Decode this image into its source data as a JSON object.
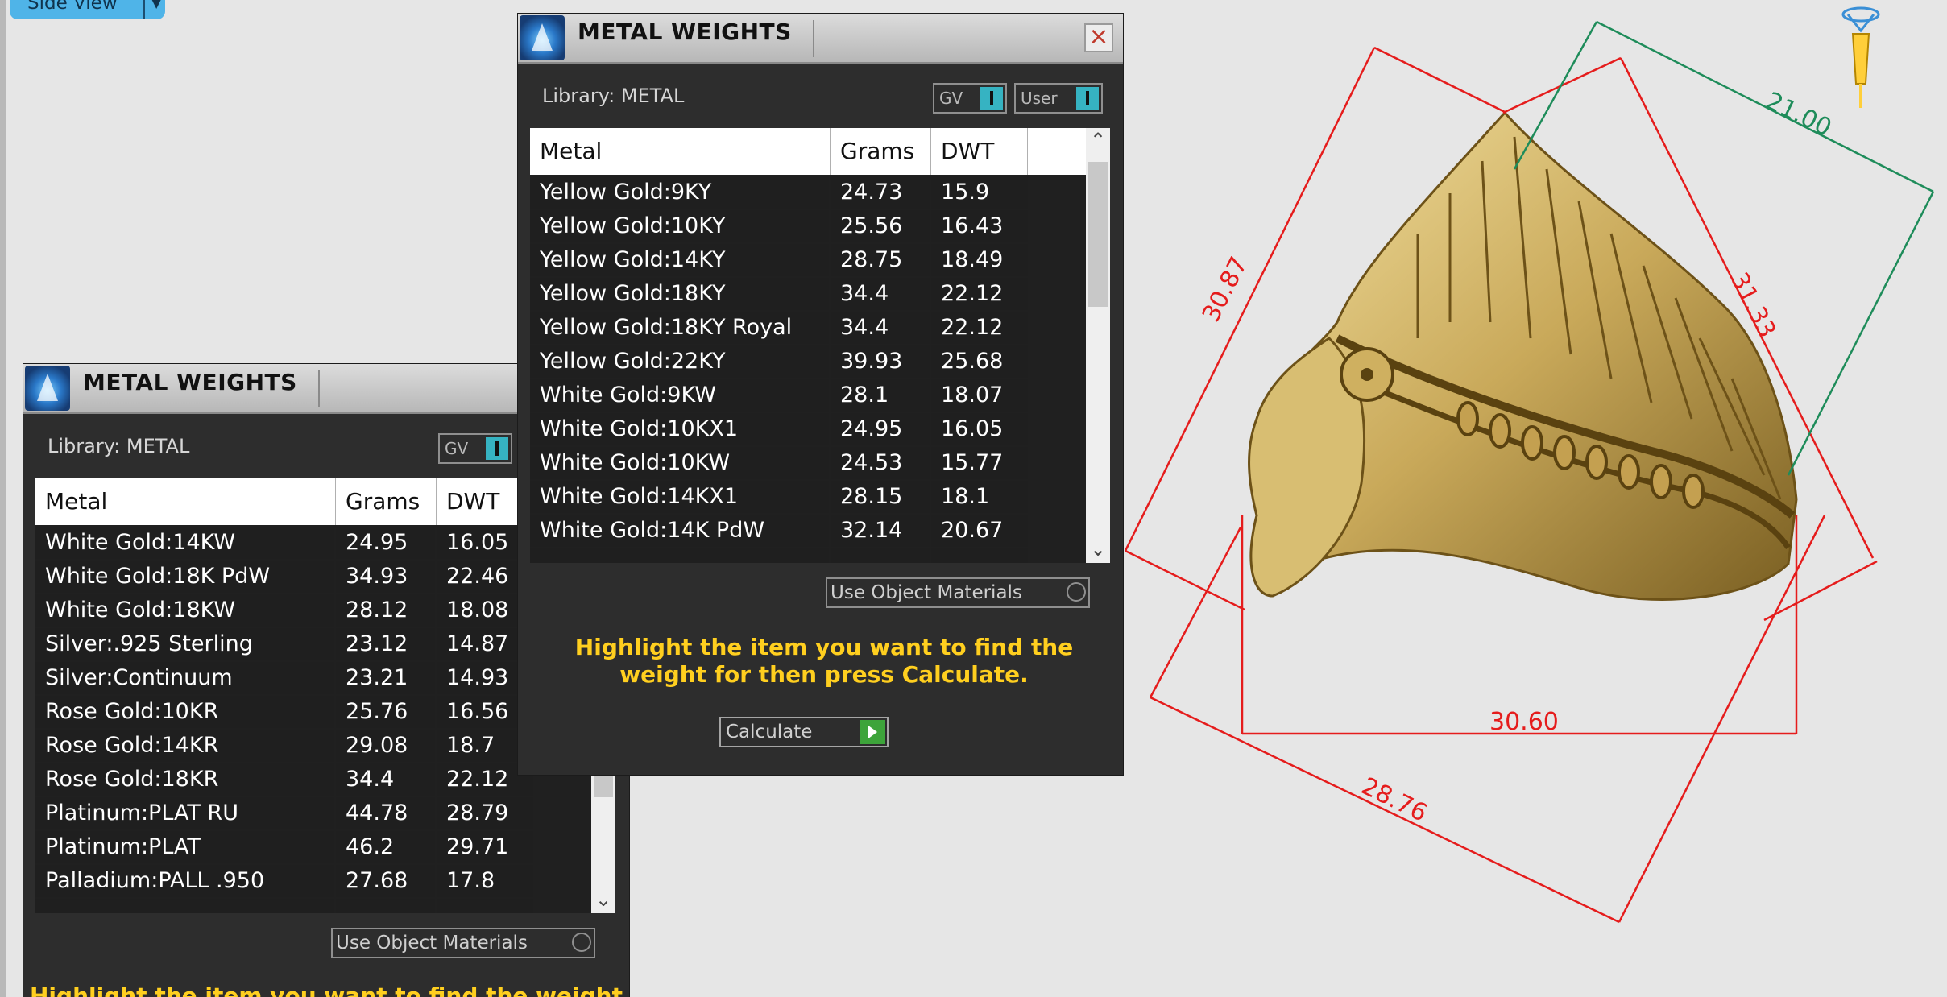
{
  "view_tab": {
    "label": "Side View"
  },
  "panels": [
    {
      "title": "METAL WEIGHTS",
      "library_label": "Library: METAL",
      "toggles": [
        {
          "label": "GV"
        },
        {
          "label": "User"
        }
      ],
      "columns": [
        "Metal",
        "Grams",
        "DWT"
      ],
      "rows": [
        [
          "Yellow Gold:9KY",
          "24.73",
          "15.9"
        ],
        [
          "Yellow Gold:10KY",
          "25.56",
          "16.43"
        ],
        [
          "Yellow Gold:14KY",
          "28.75",
          "18.49"
        ],
        [
          "Yellow Gold:18KY",
          "34.4",
          "22.12"
        ],
        [
          "Yellow Gold:18KY Royal",
          "34.4",
          "22.12"
        ],
        [
          "Yellow Gold:22KY",
          "39.93",
          "25.68"
        ],
        [
          "White Gold:9KW",
          "28.1",
          "18.07"
        ],
        [
          "White Gold:10KX1",
          "24.95",
          "16.05"
        ],
        [
          "White Gold:10KW",
          "24.53",
          "15.77"
        ],
        [
          "White Gold:14KX1",
          "28.15",
          "18.1"
        ],
        [
          "White Gold:14K PdW",
          "32.14",
          "20.67"
        ]
      ],
      "use_object_materials": "Use Object Materials",
      "hint": "Highlight the item you want to find the weight for then press Calculate.",
      "calculate": "Calculate"
    },
    {
      "title": "METAL WEIGHTS",
      "library_label": "Library: METAL",
      "toggles": [
        {
          "label": "GV"
        }
      ],
      "columns": [
        "Metal",
        "Grams",
        "DWT"
      ],
      "rows": [
        [
          "White Gold:14KW",
          "24.95",
          "16.05"
        ],
        [
          "White Gold:18K PdW",
          "34.93",
          "22.46"
        ],
        [
          "White Gold:18KW",
          "28.12",
          "18.08"
        ],
        [
          "Silver:.925 Sterling",
          "23.12",
          "14.87"
        ],
        [
          "Silver:Continuum",
          "23.21",
          "14.93"
        ],
        [
          "Rose Gold:10KR",
          "25.76",
          "16.56"
        ],
        [
          "Rose Gold:14KR",
          "29.08",
          "18.7"
        ],
        [
          "Rose Gold:18KR",
          "34.4",
          "22.12"
        ],
        [
          "Platinum:PLAT RU",
          "44.78",
          "28.79"
        ],
        [
          "Platinum:PLAT",
          "46.2",
          "29.71"
        ],
        [
          "Palladium:PALL .950",
          "27.68",
          "17.8"
        ]
      ],
      "use_object_materials": "Use Object Materials",
      "hint": "Highlight the item you want to find the weight"
    }
  ],
  "dimensions": [
    "21.00",
    "30.87",
    "31.33",
    "30.60",
    "28.76"
  ],
  "colors": {
    "dimension_red": "#e51c1c",
    "dimension_green": "#1e8c5a",
    "hint_yellow": "#ffcf1f",
    "toggle_teal": "#36b3c2"
  }
}
